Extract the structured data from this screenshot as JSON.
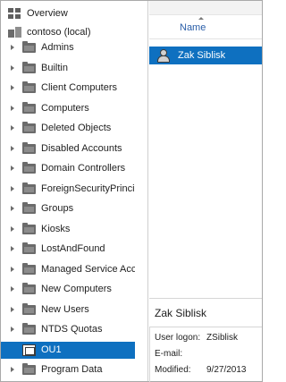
{
  "tree": {
    "overview_label": "Overview",
    "domain_label": "contoso (local)",
    "nodes": [
      {
        "label": "Admins",
        "expandable": true
      },
      {
        "label": "Builtin",
        "expandable": true
      },
      {
        "label": "Client Computers",
        "expandable": true
      },
      {
        "label": "Computers",
        "expandable": true
      },
      {
        "label": "Deleted Objects",
        "expandable": true
      },
      {
        "label": "Disabled Accounts",
        "expandable": true
      },
      {
        "label": "Domain Controllers",
        "expandable": true
      },
      {
        "label": "ForeignSecurityPrincip",
        "expandable": true
      },
      {
        "label": "Groups",
        "expandable": true
      },
      {
        "label": "Kiosks",
        "expandable": true
      },
      {
        "label": "LostAndFound",
        "expandable": true
      },
      {
        "label": "Managed Service Acco",
        "expandable": true
      },
      {
        "label": "New Computers",
        "expandable": true
      },
      {
        "label": "New Users",
        "expandable": true
      },
      {
        "label": "NTDS Quotas",
        "expandable": true
      },
      {
        "label": "OU1",
        "expandable": false,
        "selected": true
      },
      {
        "label": "Program Data",
        "expandable": true
      }
    ]
  },
  "list": {
    "column_header": "Name",
    "selected_item": "Zak Siblisk"
  },
  "details": {
    "title": "Zak Siblisk",
    "rows": [
      {
        "label": "User logon:",
        "value": "ZSiblisk"
      },
      {
        "label": "E-mail:",
        "value": ""
      },
      {
        "label": "Modified:",
        "value": "9/27/2013"
      }
    ]
  },
  "colors": {
    "selection": "#0e70c0",
    "header_text": "#2a5ea8"
  }
}
